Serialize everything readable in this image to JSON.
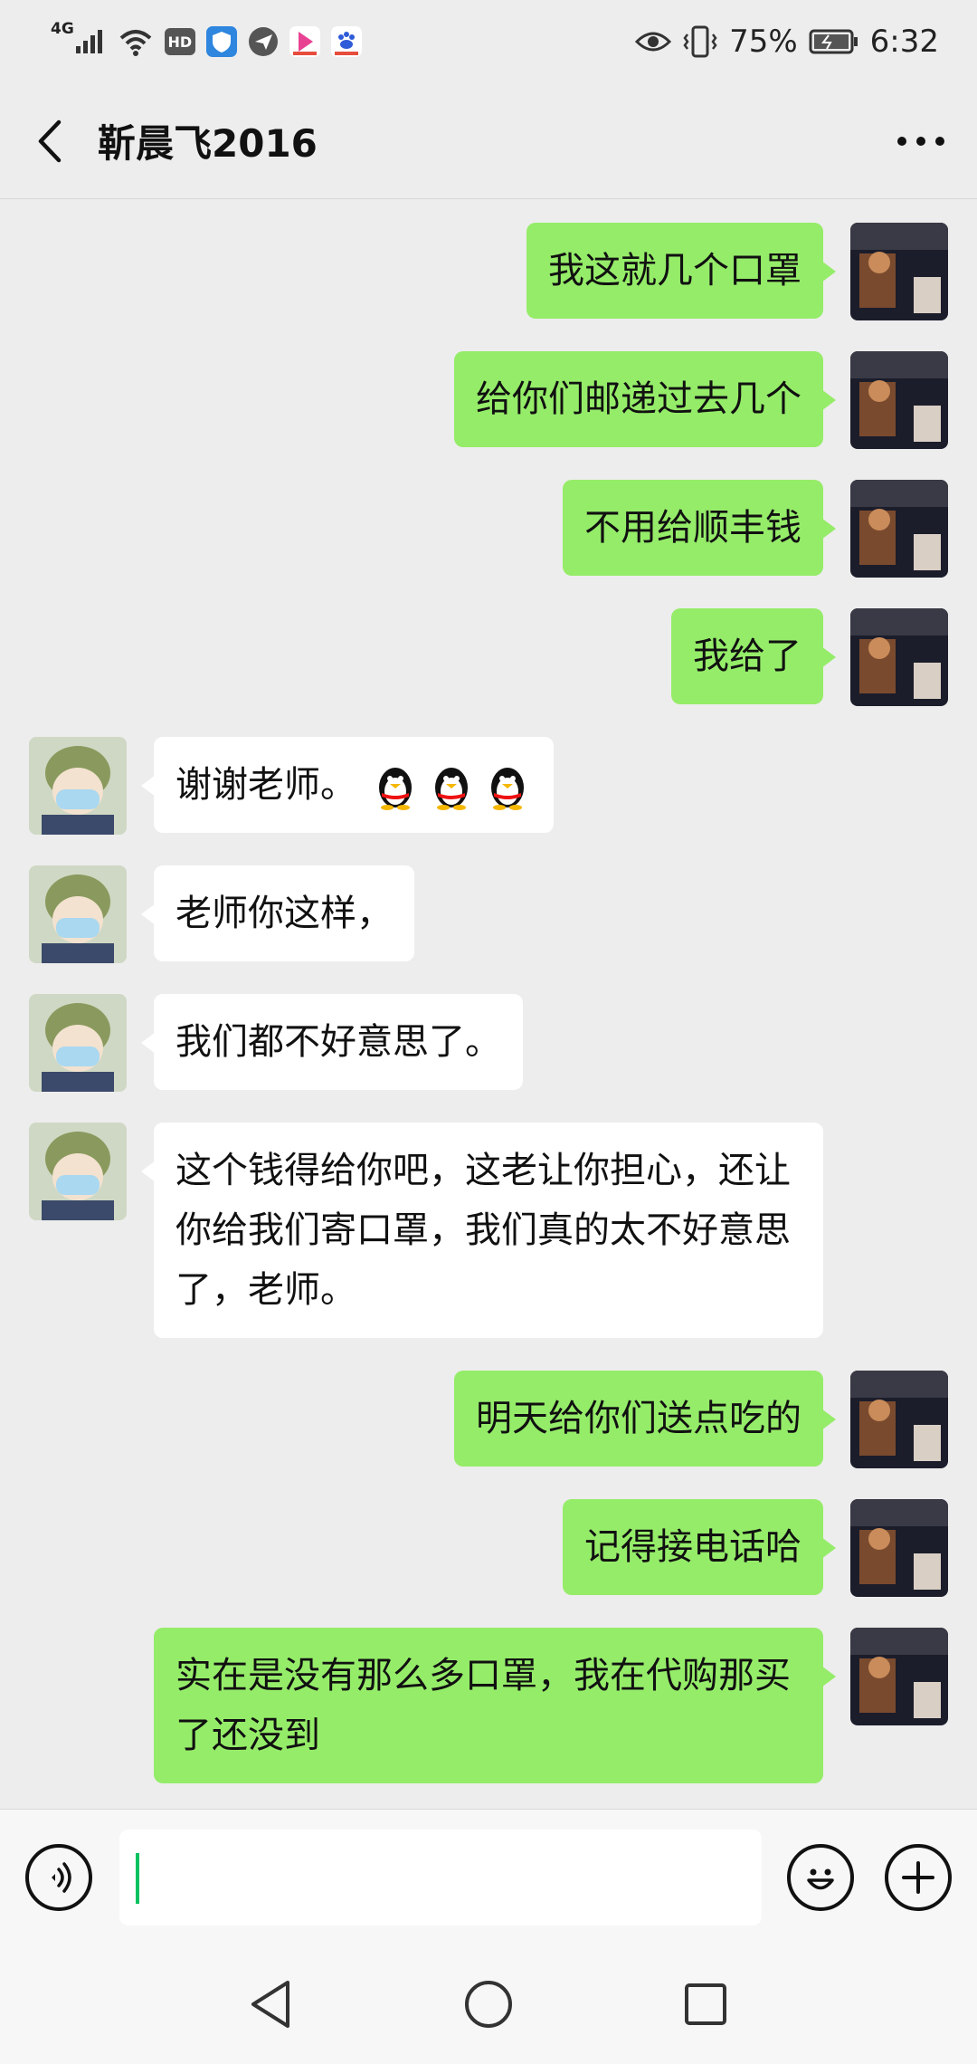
{
  "status_bar": {
    "network": "4G",
    "hd_badge": "HD",
    "battery_percent": "75%",
    "time": "6:32",
    "icons": [
      "signal-icon",
      "wifi-icon",
      "hd-icon",
      "shield-app-icon",
      "paper-plane-app-icon",
      "video-app-icon",
      "baidu-app-icon",
      "eye-icon",
      "vibrate-icon",
      "battery-icon"
    ]
  },
  "header": {
    "title": "靳晨飞2016"
  },
  "messages": [
    {
      "side": "sent",
      "text": "我这就几个口罩"
    },
    {
      "side": "sent",
      "text": "给你们邮递过去几个"
    },
    {
      "side": "sent",
      "text": "不用给顺丰钱"
    },
    {
      "side": "sent",
      "text": "我给了"
    },
    {
      "side": "recv",
      "text": "谢谢老师。",
      "emoji": "penguin-icon",
      "emoji_count": 3
    },
    {
      "side": "recv",
      "text": "老师你这样，"
    },
    {
      "side": "recv",
      "text": "我们都不好意思了。"
    },
    {
      "side": "recv",
      "text": "这个钱得给你吧，这老让你担心，还让你给我们寄口罩，我们真的太不好意思了，老师。"
    },
    {
      "side": "sent",
      "text": "明天给你们送点吃的"
    },
    {
      "side": "sent",
      "text": "记得接电话哈"
    },
    {
      "side": "sent",
      "text": "实在是没有那么多口罩，我在代购那买了还没到"
    }
  ],
  "input_bar": {
    "value": "",
    "icons": [
      "voice-icon",
      "emoji-icon",
      "plus-icon"
    ]
  },
  "nav_bar": {
    "icons": [
      "nav-back-icon",
      "nav-home-icon",
      "nav-recent-icon"
    ]
  },
  "colors": {
    "background": "#ededed",
    "sent_bubble": "#95ec69",
    "recv_bubble": "#ffffff",
    "caret": "#07c160"
  }
}
